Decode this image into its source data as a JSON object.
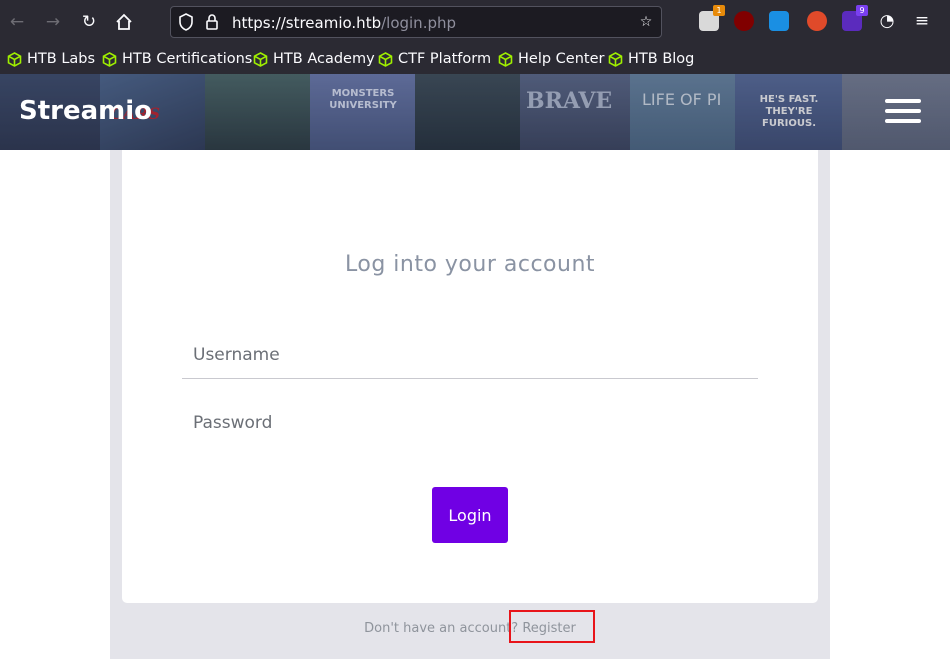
{
  "browser": {
    "url_host": "https://streamio.htb",
    "url_path": "/login.php",
    "extension_badge_a": "1",
    "extension_badge_b": "9"
  },
  "bookmarks": [
    {
      "label": "HTB Labs"
    },
    {
      "label": "HTB Certifications"
    },
    {
      "label": "HTB Academy"
    },
    {
      "label": "CTF Platform"
    },
    {
      "label": "Help Center"
    },
    {
      "label": "HTB Blog"
    }
  ],
  "site": {
    "brand": "Streamio",
    "posters": [
      "CARS",
      "MONSTERS UNIVERSITY",
      "BRAVE",
      "LIFE OF PI",
      "HE'S FAST. THEY'RE FURIOUS."
    ]
  },
  "login": {
    "title": "Log into your account",
    "username_placeholder": "Username",
    "password_placeholder": "Password",
    "button_label": "Login",
    "footer_prefix": "Don't have an account?",
    "register_link": "Register"
  },
  "colors": {
    "accent": "#7000e4",
    "annotation": "#e8141a",
    "bookmark_icon": "#9fef00"
  }
}
